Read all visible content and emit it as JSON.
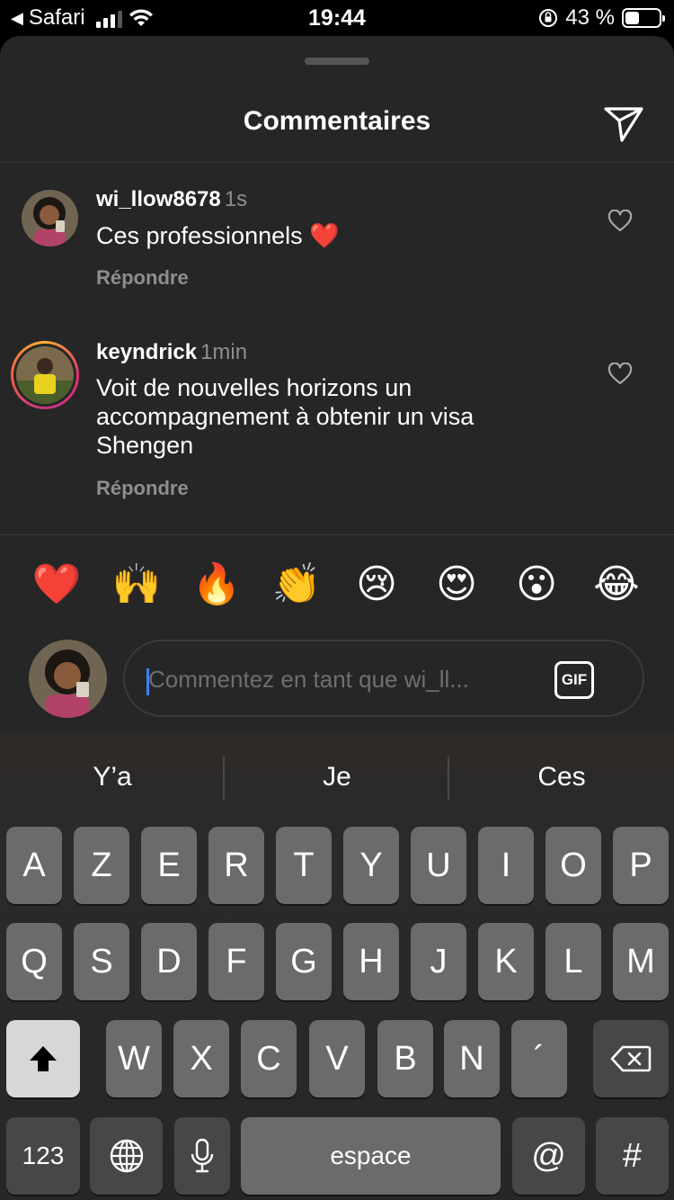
{
  "status_bar": {
    "back_app": "Safari",
    "time": "19:44",
    "battery_percent": "43 %",
    "battery_level": 0.43
  },
  "sheet": {
    "title": "Commentaires"
  },
  "comments": [
    {
      "username": "wi_llow8678",
      "time": "1s",
      "text": "Ces professionnels ❤️",
      "reply_label": "Répondre"
    },
    {
      "username": "keyndrick",
      "time": "1min",
      "text": "Voit de nouvelles horizons un accompagnement à obtenir un visa Shengen",
      "reply_label": "Répondre"
    }
  ],
  "quick_reactions": [
    "❤️",
    "🙌",
    "🔥",
    "👏",
    "😢",
    "😍",
    "😮",
    "😂"
  ],
  "composer": {
    "placeholder": "Commentez en tant que wi_ll...",
    "gif_label": "GIF"
  },
  "keyboard": {
    "suggestions": [
      "Y’a",
      "Je",
      "Ces"
    ],
    "row1": [
      "A",
      "Z",
      "E",
      "R",
      "T",
      "Y",
      "U",
      "I",
      "O",
      "P"
    ],
    "row2": [
      "Q",
      "S",
      "D",
      "F",
      "G",
      "H",
      "J",
      "K",
      "L",
      "M"
    ],
    "row3": [
      "W",
      "X",
      "C",
      "V",
      "B",
      "N",
      "´"
    ],
    "numbers_label": "123",
    "space_label": "espace",
    "at_label": "@",
    "hash_label": "#"
  }
}
